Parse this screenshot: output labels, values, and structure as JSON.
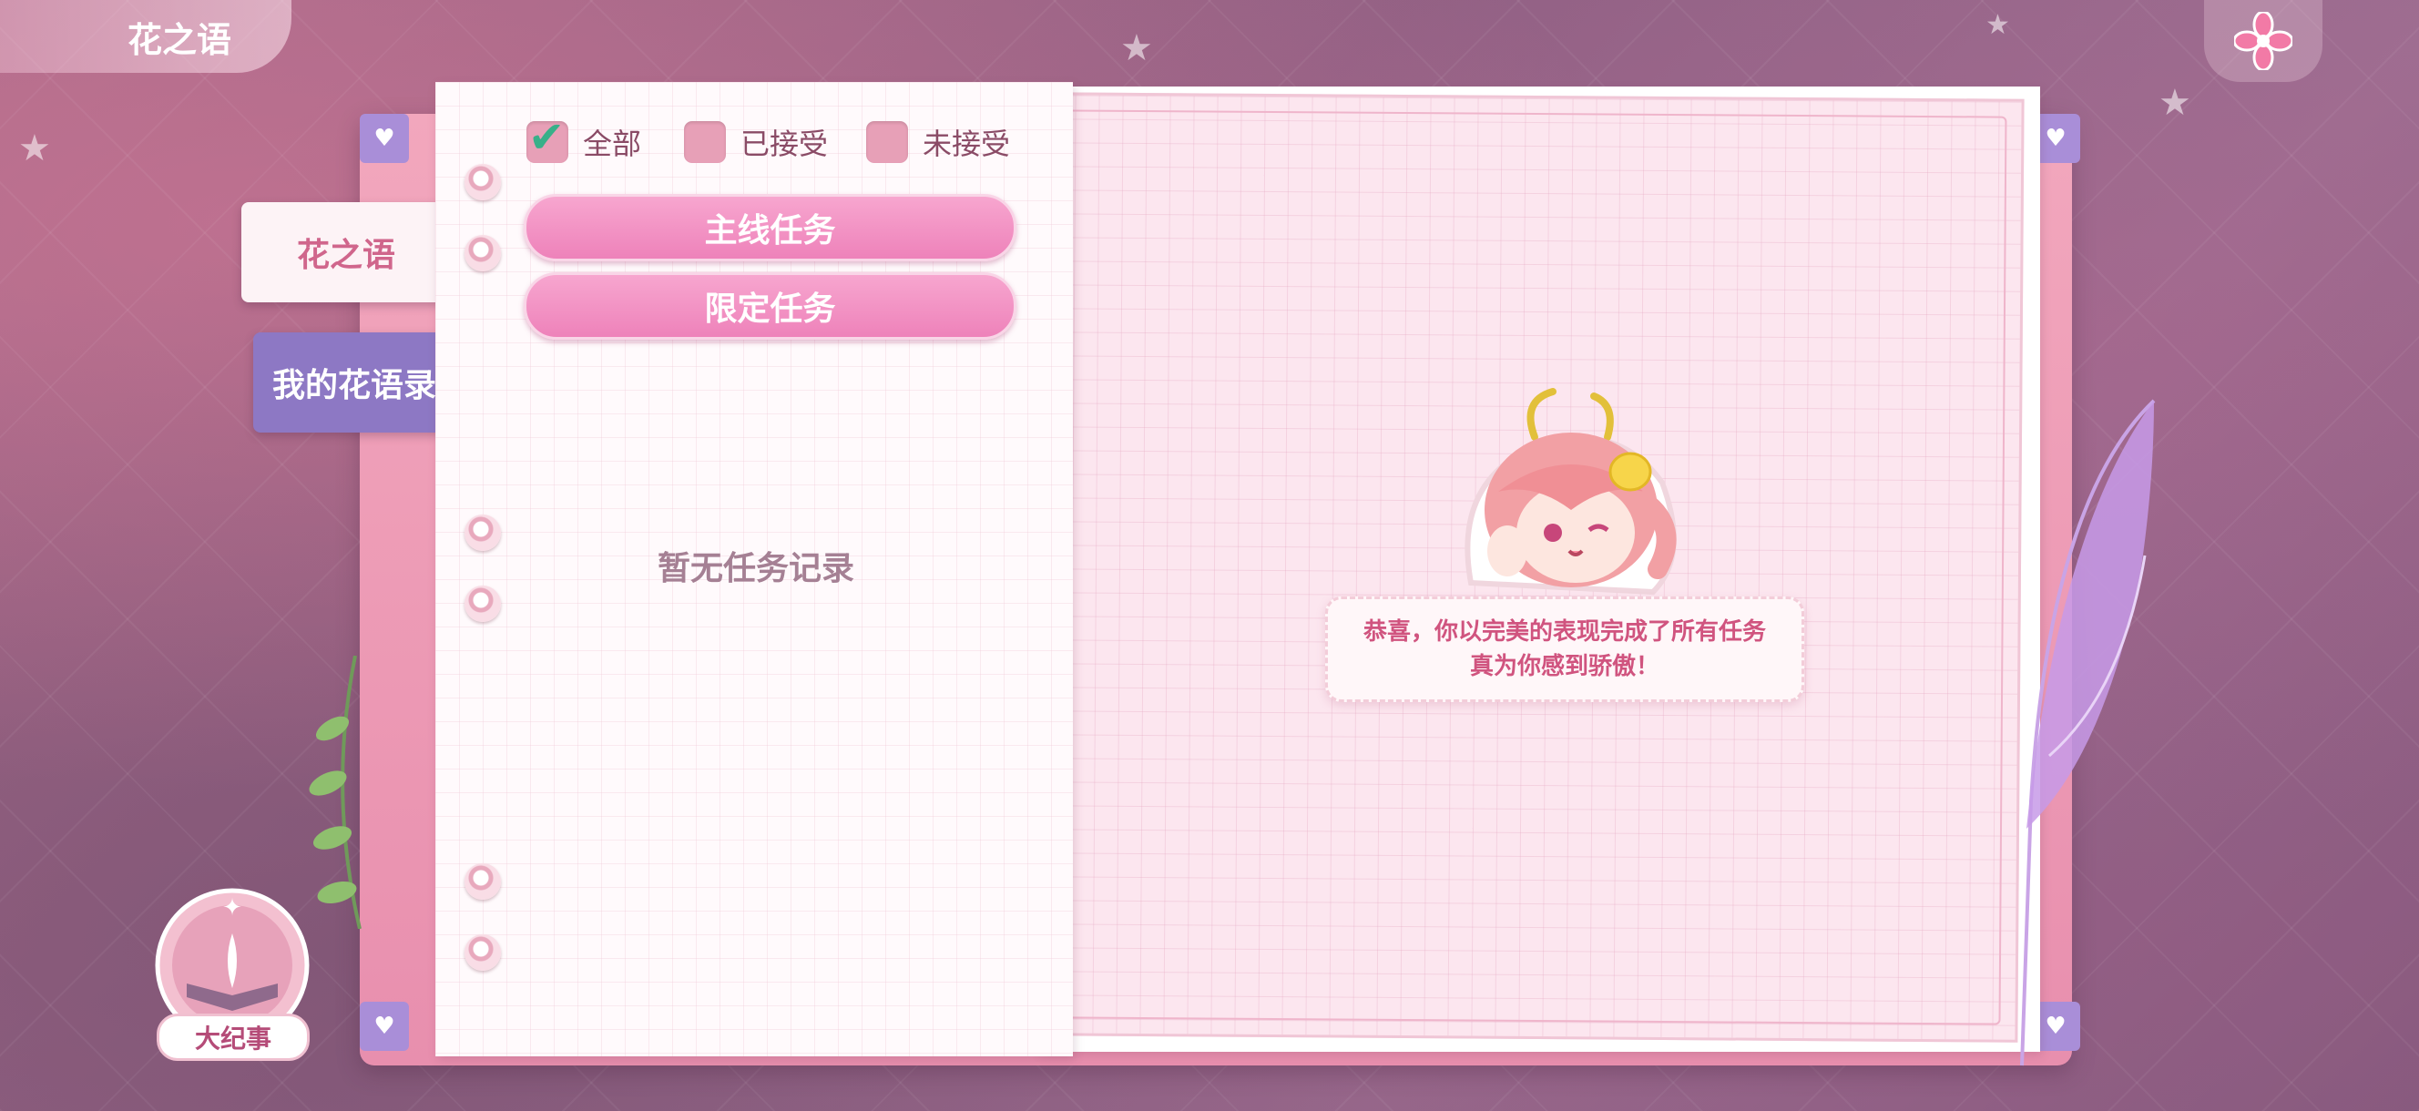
{
  "header": {
    "title": "花之语"
  },
  "side_tabs": [
    {
      "label": "花之语",
      "active": true
    },
    {
      "label": "我的花语录",
      "active": false
    }
  ],
  "filters": [
    {
      "label": "全部",
      "checked": true
    },
    {
      "label": "已接受",
      "checked": false
    },
    {
      "label": "未接受",
      "checked": false
    }
  ],
  "tasks": [
    {
      "label": "主线任务"
    },
    {
      "label": "限定任务"
    }
  ],
  "empty_message": "暂无任务记录",
  "speech": {
    "line1": "恭喜，你以完美的表现完成了所有任务",
    "line2": "真为你感到骄傲！"
  },
  "big_event": {
    "label": "大纪事"
  },
  "colors": {
    "accent": "#ee82ba",
    "tab_inactive": "#8d78c4",
    "checkbox_on": "#38b089"
  },
  "icons": {
    "close": "flower-close-icon",
    "check": "check-icon"
  }
}
